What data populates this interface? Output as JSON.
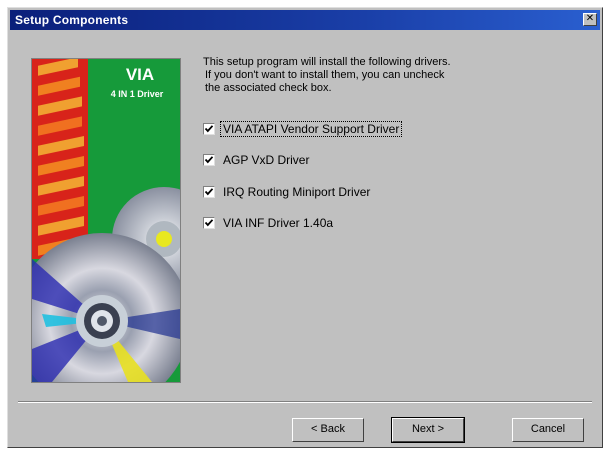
{
  "window": {
    "title": "Setup Components",
    "close_glyph": "✕"
  },
  "banner": {
    "brand": "VIA",
    "product": "4 IN 1 Driver"
  },
  "intro_lines": [
    "This setup program will install the following drivers.",
    "If you don't want to install them, you can uncheck",
    "the associated check box."
  ],
  "options": [
    {
      "label": "VIA ATAPI Vendor Support Driver",
      "checked": true,
      "focused": true
    },
    {
      "label": "AGP VxD Driver",
      "checked": true,
      "focused": false
    },
    {
      "label": "IRQ Routing Miniport Driver",
      "checked": true,
      "focused": false
    },
    {
      "label": "VIA INF Driver 1.40a",
      "checked": true,
      "focused": false
    }
  ],
  "buttons": {
    "back": "< Back",
    "next": "Next >",
    "cancel": "Cancel"
  }
}
